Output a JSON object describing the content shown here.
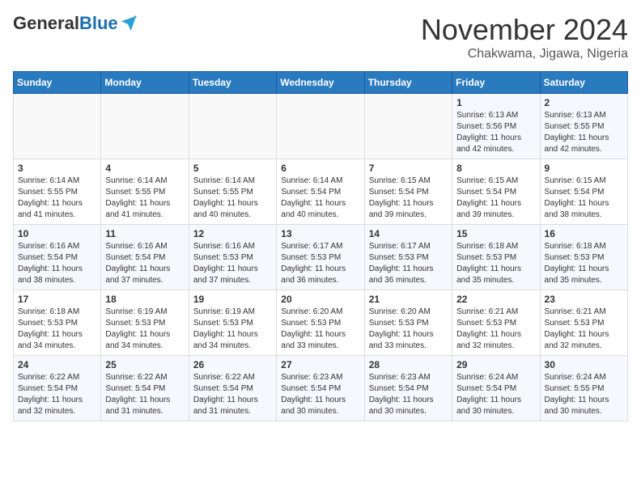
{
  "header": {
    "logo_general": "General",
    "logo_blue": "Blue",
    "month_title": "November 2024",
    "subtitle": "Chakwama, Jigawa, Nigeria"
  },
  "weekdays": [
    "Sunday",
    "Monday",
    "Tuesday",
    "Wednesday",
    "Thursday",
    "Friday",
    "Saturday"
  ],
  "weeks": [
    [
      {
        "day": "",
        "info": ""
      },
      {
        "day": "",
        "info": ""
      },
      {
        "day": "",
        "info": ""
      },
      {
        "day": "",
        "info": ""
      },
      {
        "day": "",
        "info": ""
      },
      {
        "day": "1",
        "info": "Sunrise: 6:13 AM\nSunset: 5:56 PM\nDaylight: 11 hours\nand 42 minutes."
      },
      {
        "day": "2",
        "info": "Sunrise: 6:13 AM\nSunset: 5:55 PM\nDaylight: 11 hours\nand 42 minutes."
      }
    ],
    [
      {
        "day": "3",
        "info": "Sunrise: 6:14 AM\nSunset: 5:55 PM\nDaylight: 11 hours\nand 41 minutes."
      },
      {
        "day": "4",
        "info": "Sunrise: 6:14 AM\nSunset: 5:55 PM\nDaylight: 11 hours\nand 41 minutes."
      },
      {
        "day": "5",
        "info": "Sunrise: 6:14 AM\nSunset: 5:55 PM\nDaylight: 11 hours\nand 40 minutes."
      },
      {
        "day": "6",
        "info": "Sunrise: 6:14 AM\nSunset: 5:54 PM\nDaylight: 11 hours\nand 40 minutes."
      },
      {
        "day": "7",
        "info": "Sunrise: 6:15 AM\nSunset: 5:54 PM\nDaylight: 11 hours\nand 39 minutes."
      },
      {
        "day": "8",
        "info": "Sunrise: 6:15 AM\nSunset: 5:54 PM\nDaylight: 11 hours\nand 39 minutes."
      },
      {
        "day": "9",
        "info": "Sunrise: 6:15 AM\nSunset: 5:54 PM\nDaylight: 11 hours\nand 38 minutes."
      }
    ],
    [
      {
        "day": "10",
        "info": "Sunrise: 6:16 AM\nSunset: 5:54 PM\nDaylight: 11 hours\nand 38 minutes."
      },
      {
        "day": "11",
        "info": "Sunrise: 6:16 AM\nSunset: 5:54 PM\nDaylight: 11 hours\nand 37 minutes."
      },
      {
        "day": "12",
        "info": "Sunrise: 6:16 AM\nSunset: 5:53 PM\nDaylight: 11 hours\nand 37 minutes."
      },
      {
        "day": "13",
        "info": "Sunrise: 6:17 AM\nSunset: 5:53 PM\nDaylight: 11 hours\nand 36 minutes."
      },
      {
        "day": "14",
        "info": "Sunrise: 6:17 AM\nSunset: 5:53 PM\nDaylight: 11 hours\nand 36 minutes."
      },
      {
        "day": "15",
        "info": "Sunrise: 6:18 AM\nSunset: 5:53 PM\nDaylight: 11 hours\nand 35 minutes."
      },
      {
        "day": "16",
        "info": "Sunrise: 6:18 AM\nSunset: 5:53 PM\nDaylight: 11 hours\nand 35 minutes."
      }
    ],
    [
      {
        "day": "17",
        "info": "Sunrise: 6:18 AM\nSunset: 5:53 PM\nDaylight: 11 hours\nand 34 minutes."
      },
      {
        "day": "18",
        "info": "Sunrise: 6:19 AM\nSunset: 5:53 PM\nDaylight: 11 hours\nand 34 minutes."
      },
      {
        "day": "19",
        "info": "Sunrise: 6:19 AM\nSunset: 5:53 PM\nDaylight: 11 hours\nand 34 minutes."
      },
      {
        "day": "20",
        "info": "Sunrise: 6:20 AM\nSunset: 5:53 PM\nDaylight: 11 hours\nand 33 minutes."
      },
      {
        "day": "21",
        "info": "Sunrise: 6:20 AM\nSunset: 5:53 PM\nDaylight: 11 hours\nand 33 minutes."
      },
      {
        "day": "22",
        "info": "Sunrise: 6:21 AM\nSunset: 5:53 PM\nDaylight: 11 hours\nand 32 minutes."
      },
      {
        "day": "23",
        "info": "Sunrise: 6:21 AM\nSunset: 5:53 PM\nDaylight: 11 hours\nand 32 minutes."
      }
    ],
    [
      {
        "day": "24",
        "info": "Sunrise: 6:22 AM\nSunset: 5:54 PM\nDaylight: 11 hours\nand 32 minutes."
      },
      {
        "day": "25",
        "info": "Sunrise: 6:22 AM\nSunset: 5:54 PM\nDaylight: 11 hours\nand 31 minutes."
      },
      {
        "day": "26",
        "info": "Sunrise: 6:22 AM\nSunset: 5:54 PM\nDaylight: 11 hours\nand 31 minutes."
      },
      {
        "day": "27",
        "info": "Sunrise: 6:23 AM\nSunset: 5:54 PM\nDaylight: 11 hours\nand 30 minutes."
      },
      {
        "day": "28",
        "info": "Sunrise: 6:23 AM\nSunset: 5:54 PM\nDaylight: 11 hours\nand 30 minutes."
      },
      {
        "day": "29",
        "info": "Sunrise: 6:24 AM\nSunset: 5:54 PM\nDaylight: 11 hours\nand 30 minutes."
      },
      {
        "day": "30",
        "info": "Sunrise: 6:24 AM\nSunset: 5:55 PM\nDaylight: 11 hours\nand 30 minutes."
      }
    ]
  ]
}
